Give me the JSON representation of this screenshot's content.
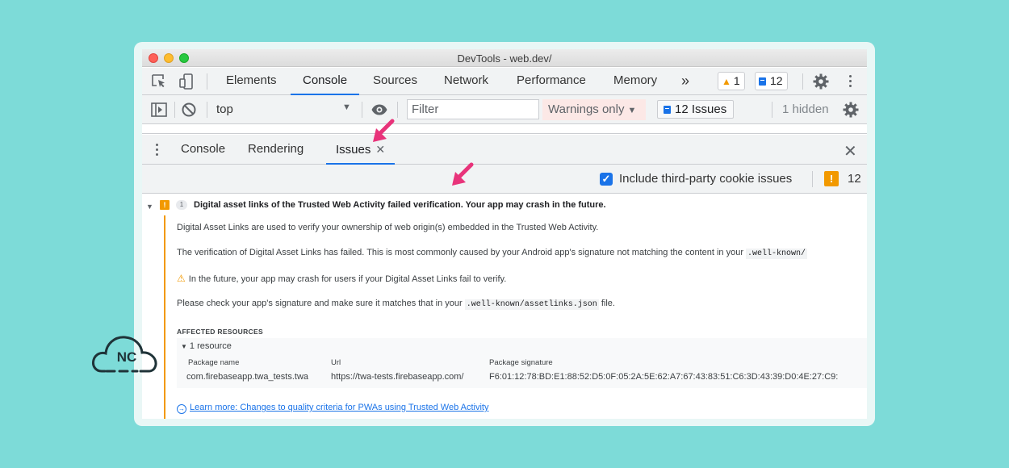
{
  "window": {
    "title": "DevTools - web.dev/"
  },
  "main_tabs": [
    {
      "label": "Elements"
    },
    {
      "label": "Console"
    },
    {
      "label": "Sources"
    },
    {
      "label": "Network"
    },
    {
      "label": "Performance"
    },
    {
      "label": "Memory"
    }
  ],
  "more_tabs_label": "»",
  "warning_badge_count": "1",
  "message_badge_count": "12",
  "console_toolbar": {
    "context": "top",
    "filter_placeholder": "Filter",
    "levels": "Warnings only",
    "issues_button": "12 Issues",
    "hidden": "1 hidden"
  },
  "drawer_tabs": [
    {
      "label": "Console"
    },
    {
      "label": "Rendering"
    },
    {
      "label": "Issues"
    }
  ],
  "issues_toolbar": {
    "checkbox_label": "Include third-party cookie issues",
    "issue_count": "12"
  },
  "issue": {
    "count": "1",
    "title": "Digital asset links of the Trusted Web Activity failed verification. Your app may crash in the future.",
    "p1": "Digital Asset Links are used to verify your ownership of web origin(s) embedded in the Trusted Web Activity.",
    "p2_before": "The verification of Digital Asset Links has failed. This is most commonly caused by your Android app's signature not matching the content in your",
    "p2_code": ".well-known/",
    "p3": "In the future, your app may crash for users if your Digital Asset Links fail to verify.",
    "p4_before": "Please check your app's signature and make sure it matches that in your",
    "p4_code": ".well-known/assetlinks.json",
    "p4_after": "file.",
    "affected_heading": "AFFECTED RESOURCES",
    "resource_toggle": "1 resource",
    "columns": [
      "Package name",
      "Url",
      "Package signature"
    ],
    "row": [
      "com.firebaseapp.twa_tests.twa",
      "https://twa-tests.firebaseapp.com/",
      "F6:01:12:78:BD:E1:88:52:D5:0F:05:2A:5E:62:A7:67:43:83:51:C6:3D:43:39:D0:4E:27:C9:"
    ],
    "learn_more": "Learn more: Changes to quality criteria for PWAs using Trusted Web Activity"
  },
  "logo_text": "NC",
  "colors": {
    "background": "#7ddbd8",
    "accent": "#1a73e8",
    "warning": "#f29900",
    "annotation_arrow": "#e8337a"
  }
}
